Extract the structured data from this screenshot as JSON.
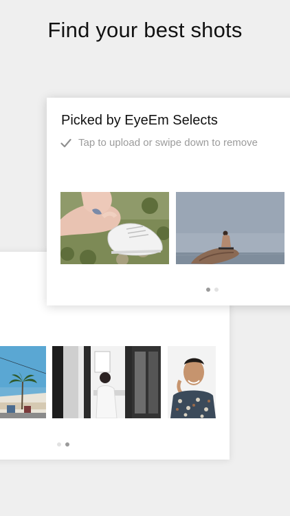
{
  "headline": "Find your best shots",
  "selects_card": {
    "title": "Picked by EyeEm Selects",
    "hint": "Tap to upload or swipe down to remove",
    "check_icon": "check-icon",
    "photos": [
      {
        "name": "photo-sneakers-on-grass"
      },
      {
        "name": "photo-man-on-rock-by-sea"
      }
    ],
    "page_dots": 2,
    "active_dot": 0
  },
  "back_card": {
    "photos": [
      {
        "name": "photo-palm-tree-street"
      },
      {
        "name": "photo-man-in-white-shirt-doorway"
      },
      {
        "name": "photo-portrait-man-patterned-shirt"
      }
    ],
    "page_dots": 2,
    "active_dot": 1
  },
  "colors": {
    "background": "#efefef",
    "card": "#ffffff",
    "hint_text": "#9b9b9b",
    "dot_active": "#9a9a9a",
    "dot_inactive": "#e2e2e2"
  }
}
